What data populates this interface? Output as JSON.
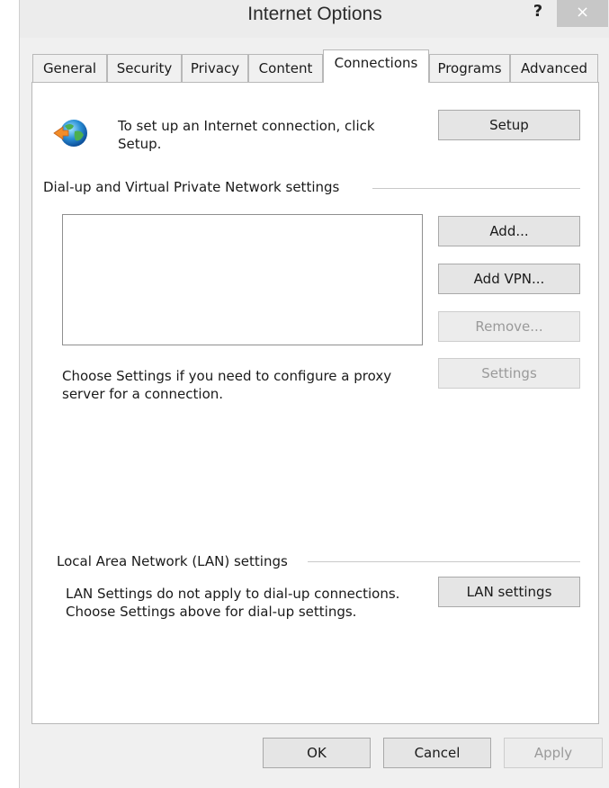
{
  "window": {
    "title": "Internet Options",
    "help_label": "?",
    "close_label": "×"
  },
  "tabs": [
    {
      "label": "General",
      "active": false
    },
    {
      "label": "Security",
      "active": false
    },
    {
      "label": "Privacy",
      "active": false
    },
    {
      "label": "Content",
      "active": false
    },
    {
      "label": "Connections",
      "active": true
    },
    {
      "label": "Programs",
      "active": false
    },
    {
      "label": "Advanced",
      "active": false
    }
  ],
  "setup": {
    "text_line1": "To set up an Internet connection, click",
    "text_line2": "Setup.",
    "button_label": "Setup",
    "icon": "globe-connection-icon"
  },
  "dialup": {
    "group_label": "Dial-up and Virtual Private Network settings",
    "connections": [],
    "add_label": "Add...",
    "add_vpn_label": "Add VPN...",
    "remove_label": "Remove...",
    "settings_label": "Settings",
    "proxy_text_line1": "Choose Settings if you need to configure a proxy",
    "proxy_text_line2": "server for a connection."
  },
  "lan": {
    "group_label": "Local Area Network (LAN) settings",
    "text_line1": "LAN Settings do not apply to dial-up connections.",
    "text_line2": "Choose Settings above for dial-up settings.",
    "button_label": "LAN settings"
  },
  "footer": {
    "ok_label": "OK",
    "cancel_label": "Cancel",
    "apply_label": "Apply"
  }
}
